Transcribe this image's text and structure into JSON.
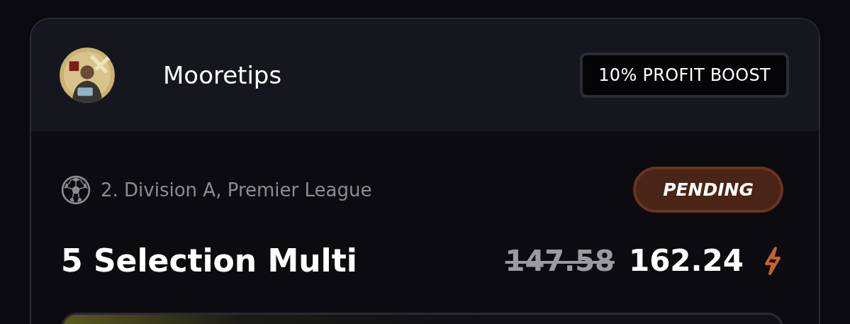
{
  "tipster": {
    "name": "Mooretips"
  },
  "boost_badge": "10% PROFIT BOOST",
  "bet": {
    "league": "2. Division A, Premier League",
    "status": {
      "label": "PENDING",
      "kind": "pending"
    },
    "title": "5 Selection Multi",
    "original_odds": "147.58",
    "boosted_odds": "162.24"
  }
}
